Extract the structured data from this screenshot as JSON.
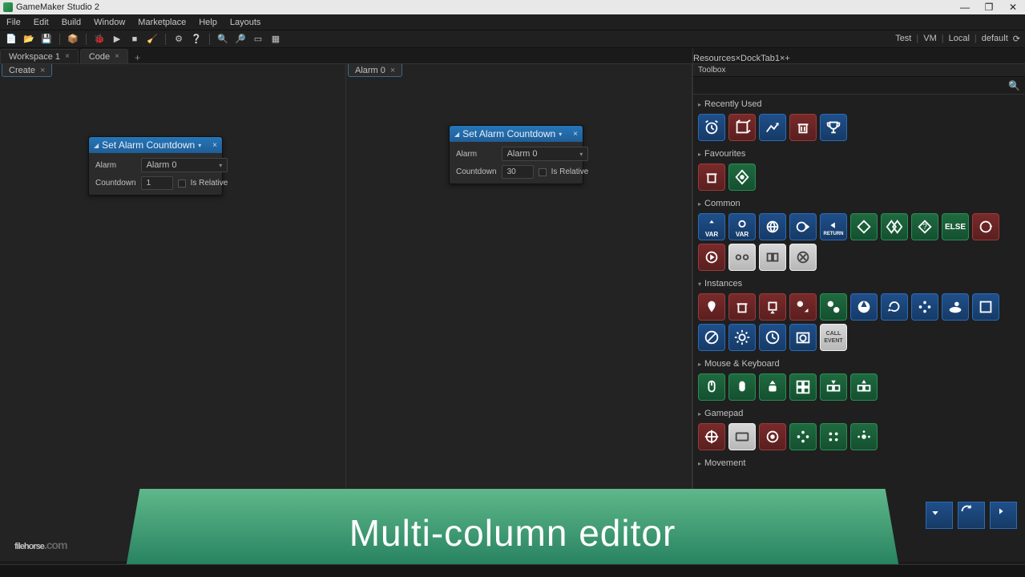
{
  "app": {
    "title": "GameMaker Studio 2"
  },
  "menu": [
    "File",
    "Edit",
    "Build",
    "Window",
    "Marketplace",
    "Help",
    "Layouts"
  ],
  "status": {
    "a": "Test",
    "b": "VM",
    "c": "Local",
    "d": "default"
  },
  "left_tabs": [
    {
      "label": "Workspace 1"
    },
    {
      "label": "Code"
    }
  ],
  "col1": {
    "tab": "Create",
    "node": {
      "title": "Set Alarm Countdown",
      "alarm_label": "Alarm",
      "alarm_value": "Alarm 0",
      "cd_label": "Countdown",
      "cd_value": "1",
      "rel": "Is Relative"
    }
  },
  "col2": {
    "tab": "Alarm 0",
    "node": {
      "title": "Set Alarm Countdown",
      "alarm_label": "Alarm",
      "alarm_value": "Alarm 0",
      "cd_label": "Countdown",
      "cd_value": "30",
      "rel": "Is Relative"
    }
  },
  "right_tabs": [
    {
      "label": "Resources"
    },
    {
      "label": "DockTab1"
    }
  ],
  "panel_title": "Toolbox",
  "search_placeholder": "",
  "sections": {
    "recent": "Recently Used",
    "fav": "Favourites",
    "common": "Common",
    "inst": "Instances",
    "mk": "Mouse & Keyboard",
    "gp": "Gamepad",
    "mv": "Movement"
  },
  "common_labels": {
    "var": "VAR",
    "return": "RETURN",
    "else": "ELSE",
    "call": "CALL\nEVENT"
  },
  "banner": "Multi-column editor",
  "watermark": {
    "a": "filehorse",
    "b": ".com"
  }
}
